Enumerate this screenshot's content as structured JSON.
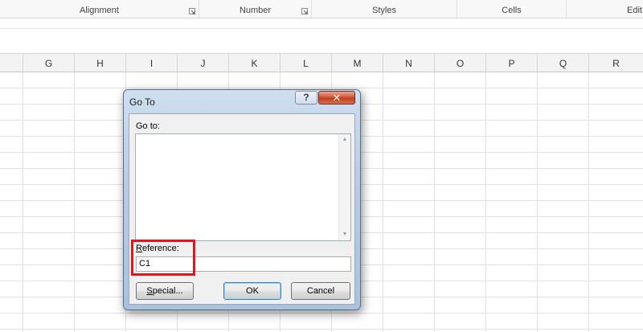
{
  "ribbon": {
    "groups": [
      {
        "label": "Alignment",
        "launcher": true
      },
      {
        "label": "Number",
        "launcher": true
      },
      {
        "label": "Styles",
        "launcher": false
      },
      {
        "label": "Cells",
        "launcher": false
      },
      {
        "label": "Edit",
        "launcher": false
      }
    ]
  },
  "columns": [
    "G",
    "H",
    "I",
    "J",
    "K",
    "L",
    "M",
    "N",
    "O",
    "P",
    "Q",
    "R"
  ],
  "dialog": {
    "title": "Go To",
    "help_glyph": "?",
    "close_glyph": "✕",
    "goto_label": "Go to:",
    "goto_items": [],
    "reference_label_first": "R",
    "reference_label_rest": "eference:",
    "reference_value": "C1",
    "special_first": "S",
    "special_rest": "pecial...",
    "ok_label": "OK",
    "cancel_label": "Cancel",
    "highlight_color": "#e2151c"
  }
}
